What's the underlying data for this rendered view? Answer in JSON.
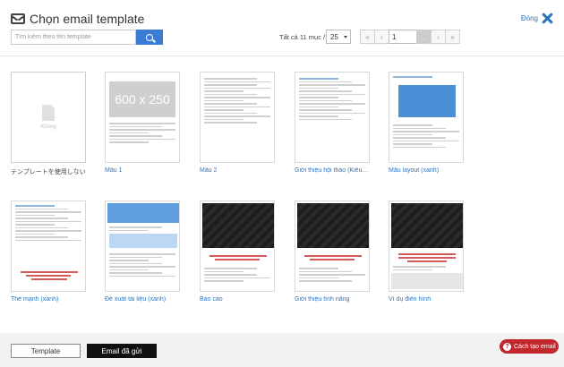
{
  "header": {
    "title": "Chọn email template",
    "close_label": "Đóng"
  },
  "search": {
    "placeholder": "Tìm kiếm theo tên template"
  },
  "pagination": {
    "total_label": "Tất cả 11 mục /",
    "page_size": "25",
    "first": "«",
    "prev": "‹",
    "page": "1",
    "next": "›",
    "last": "»"
  },
  "templates": [
    {
      "label": "テンプレートを使用しない",
      "empty_text": "Không",
      "style": "dark"
    },
    {
      "label": "Mẫu 1",
      "placeholder_text": "600 x 250",
      "style": "blue"
    },
    {
      "label": "Mẫu 2",
      "style": "blue"
    },
    {
      "label": "Giới thiệu hội thảo (Kiểu chữ...",
      "style": "blue"
    },
    {
      "label": "Mẫu layout (xanh)",
      "style": "blue"
    },
    {
      "label": "Thế mạnh (xanh)",
      "style": "blue"
    },
    {
      "label": "Đề xuất tài liệu (xanh)",
      "style": "blue"
    },
    {
      "label": "Báo cáo",
      "style": "blue"
    },
    {
      "label": "Giới thiệu tính năng",
      "style": "blue"
    },
    {
      "label": "Ví dụ điển hình",
      "style": "blue"
    }
  ],
  "footer": {
    "template_tab": "Template",
    "sent_tab": "Email đã gửi"
  },
  "help": {
    "label": "Cách tạo email"
  },
  "colors": {
    "accent": "#3a7bd5",
    "link": "#2b74bd",
    "help": "#c1272d"
  }
}
